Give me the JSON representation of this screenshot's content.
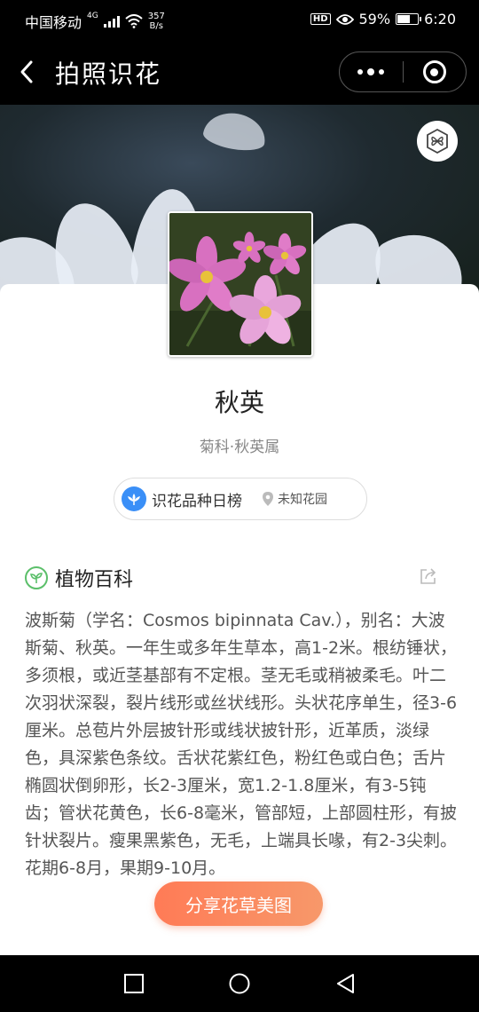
{
  "status_bar": {
    "carrier": "中国移动",
    "network": "4G",
    "speed_value": "357",
    "speed_unit": "B/s",
    "hd_badge": "HD",
    "battery_percent": "59%",
    "battery_level": 0.59,
    "time": "6:20"
  },
  "nav": {
    "title": "拍照识花"
  },
  "plant": {
    "name": "秋英",
    "taxonomy": "菊科·秋英属",
    "rank_label": "识花品种日榜",
    "garden": "未知花园"
  },
  "section": {
    "title": "植物百科",
    "description": "波斯菊（学名：Cosmos bipinnata Cav.），别名：大波斯菊、秋英。一年生或多年生草本，高1-2米。根纺锤状，多须根，或近茎基部有不定根。茎无毛或稍被柔毛。叶二次羽状深裂，裂片线形或丝状线形。头状花序单生，径3-6厘米。总苞片外层披针形或线状披针形，近革质，淡绿色，具深紫色条纹。舌状花紫红色，粉红色或白色；舌片椭圆状倒卵形，长2-3厘米，宽1.2-1.8厘米，有3-5钝齿；管状花黄色，长6-8毫米，管部短，上部圆柱形，有披针状裂片。瘦果黑紫色，无毛，上端具长喙，有2-3尖刺。花期6-8月，果期9-10月。"
  },
  "share_button": {
    "label": "分享花草美图"
  },
  "icons": {
    "back": "back-arrow-icon",
    "more": "more-dots-icon",
    "close": "mini-program-close-icon",
    "hero_badge": "flower-badge-icon",
    "rank": "flower-rank-icon",
    "location": "location-pin-icon",
    "leaf": "leaf-icon",
    "share": "share-icon"
  },
  "colors": {
    "accent_orange": "#ff7b56",
    "rank_blue": "#3a8ff7",
    "leaf_green": "#5bbf6a"
  }
}
